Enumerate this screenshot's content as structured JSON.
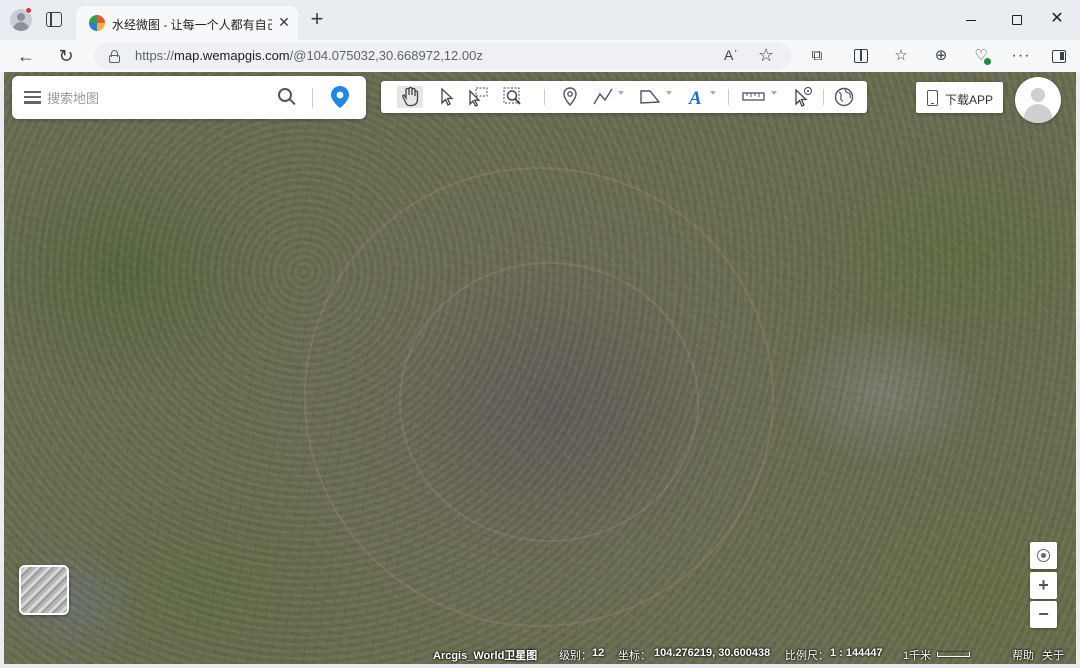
{
  "browser": {
    "tab_title": "水经微图 - 让每一个人都有自己的",
    "tab_close": "✕",
    "new_tab": "+",
    "url_prefix": "https://",
    "url_host": "map.wemapgis.com",
    "url_path": "/@104.075032,30.668972,12.00z",
    "read_aloud_glyph": "Aʾ",
    "star_glyph": "☆",
    "more_glyph": "···",
    "window_close_glyph": "✕",
    "back_glyph": "←",
    "refresh_glyph": "↻",
    "extensions_glyph": "⧉",
    "favorites_glyph": "☆",
    "collections_glyph": "⊕",
    "performance_glyph": "♡"
  },
  "search": {
    "placeholder": "搜索地图"
  },
  "toolbar": {
    "tools": [
      "pan-hand",
      "select-arrow",
      "select-box",
      "zoom-box",
      "marker-point",
      "draw-line",
      "draw-polygon",
      "text-label",
      "ruler-measure",
      "identify-pointer",
      "globe-basemap"
    ],
    "active_tool": "pan-hand"
  },
  "header": {
    "download_label": "下载APP"
  },
  "controls": {
    "zoom_in": "+",
    "zoom_out": "−"
  },
  "status": {
    "layer_name": "Arcgis_World卫星图",
    "level_label": "级别：",
    "level_value": "12",
    "coord_label": "坐标：",
    "coord_value": "104.276219, 30.600438",
    "scale_label": "比例尺：",
    "scale_value": "1 : 144447",
    "scale_bar_label": "1千米",
    "help": "帮助",
    "about": "关于"
  },
  "colors": {
    "accent_blue": "#1e88e5",
    "map_base": "#6b6e52"
  }
}
